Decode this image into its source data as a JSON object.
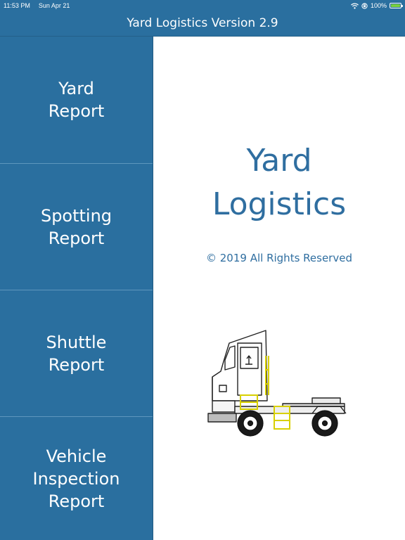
{
  "status_bar": {
    "time": "11:53 PM",
    "date": "Sun Apr 21",
    "battery_percent": "100%",
    "battery_level": 1.0,
    "icons": [
      "wifi-icon",
      "orientation-lock-icon",
      "battery-icon"
    ]
  },
  "header": {
    "title": "Yard Logistics Version 2.9"
  },
  "sidebar": {
    "items": [
      {
        "label": "Yard\nReport"
      },
      {
        "label": "Spotting\nReport"
      },
      {
        "label": "Shuttle\nReport"
      },
      {
        "label": "Vehicle\nInspection\nReport"
      }
    ]
  },
  "main": {
    "app_name": "Yard\nLogistics",
    "copyright": "© 2019 All Rights Reserved",
    "illustration": "yard-truck-illustration"
  },
  "colors": {
    "brand_blue": "#2a6f9f",
    "text_blue": "#2f6ea0",
    "battery_green": "#7ad13b",
    "truck_yellow": "#e6e21a"
  }
}
